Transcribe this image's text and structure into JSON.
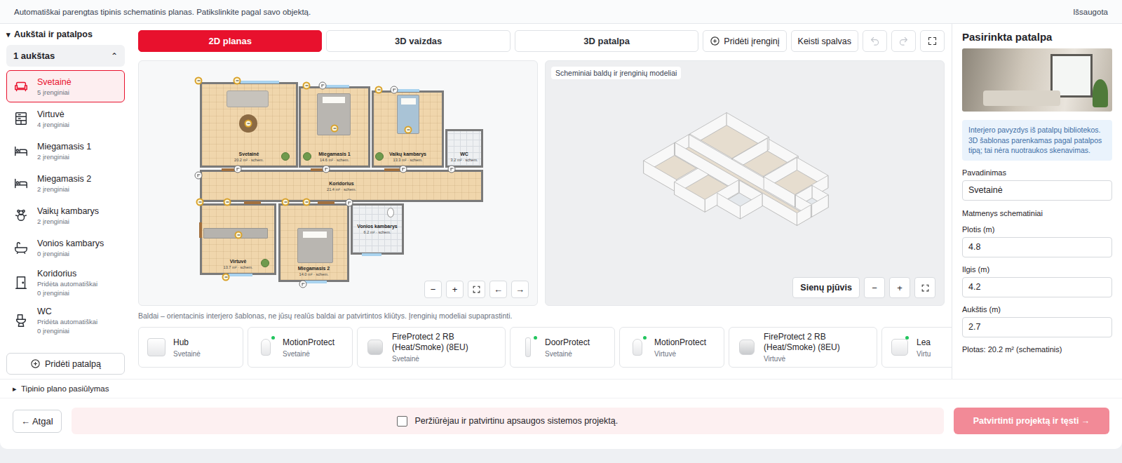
{
  "banner": {
    "text": "Automatiškai parengtas tipinis schematinis planas. Patikslinkite pagal savo objektą.",
    "status": "Išsaugota"
  },
  "sidebar": {
    "toggle": "▾",
    "title": "Aukštai ir patalpos",
    "expanded": true,
    "floor": {
      "label": "1 aukštas",
      "toggle": "⌃",
      "expanded": true
    },
    "rooms": [
      {
        "name": "Svetainė",
        "kind": "living",
        "count": "5 įrenginiai",
        "selected": true
      },
      {
        "name": "Virtuvė",
        "kind": "kitchen",
        "count": "4 įrenginiai",
        "selected": false
      },
      {
        "name": "Miegamasis 1",
        "kind": "bedroom",
        "count": "2 įrenginiai",
        "selected": false
      },
      {
        "name": "Miegamasis 2",
        "kind": "bedroom",
        "count": "2 įrenginiai",
        "selected": false
      },
      {
        "name": "Vaikų kambarys",
        "kind": "kids",
        "count": "2 įrenginiai",
        "selected": false
      },
      {
        "name": "Vonios kambarys",
        "kind": "bath",
        "count": "0 įrenginiai",
        "selected": false
      },
      {
        "name": "Koridorius",
        "kind": "corridor",
        "note": "Pridėta automatiškai",
        "count": "0 įrenginiai",
        "selected": false
      },
      {
        "name": "WC",
        "kind": "wc",
        "note": "Pridėta automatiškai",
        "count": "0 įrenginiai",
        "selected": false
      }
    ],
    "add_room": "Pridėti patalpą"
  },
  "tabs": [
    {
      "label": "2D planas",
      "selected": true
    },
    {
      "label": "3D vaizdas",
      "selected": false
    },
    {
      "label": "3D patalpa",
      "selected": false
    }
  ],
  "toolbar": {
    "buttons": [
      {
        "kind": "add",
        "label": "Pridėti įrenginį"
      },
      {
        "kind": "plain",
        "label": "Keisti spalvas"
      }
    ],
    "icons": [
      {
        "kind": "undo",
        "disabled": true
      },
      {
        "kind": "redo",
        "disabled": true
      },
      {
        "kind": "fullscreen",
        "disabled": false
      }
    ]
  },
  "plan": {
    "rooms": [
      {
        "name": "Svetainė",
        "area": "20.2 m² · schem.",
        "kind": "wood"
      },
      {
        "name": "Miegamasis 1",
        "area": "14.6 m² · schem.",
        "kind": "wood"
      },
      {
        "name": "Vaikų kambarys",
        "area": "13.3 m² · schem.",
        "kind": "wood"
      },
      {
        "name": "WC",
        "area": "3.2 m² · schem.",
        "kind": "tiles"
      },
      {
        "name": "Koridorius",
        "area": "21.4 m² · schem.",
        "kind": "wood"
      },
      {
        "name": "Virtuvė",
        "area": "13.7 m² · schem.",
        "kind": "wood"
      },
      {
        "name": "Miegamasis 2",
        "area": "14.0 m² · schem.",
        "kind": "wood"
      },
      {
        "name": "Vonios kambarys",
        "area": "6.2 m² · schem.",
        "kind": "tiles"
      }
    ],
    "controls": {
      "zoom_out": "−",
      "zoom_in": "+",
      "prev": "←",
      "next": "→"
    }
  },
  "view3d": {
    "badge": "Scheminiai baldų ir įrenginių modeliai",
    "section": "Sienų pjūvis",
    "zoom_out": "−",
    "zoom_in": "+"
  },
  "caption": "Baldai – orientacinis interjero šablonas, ne jūsų realūs baldai ar patvirtintos kliūtys. Įrenginių modeliai supaprastinti.",
  "devices": [
    {
      "name": "Hub",
      "room": "Svetainė",
      "kind": "hub",
      "online": false
    },
    {
      "name": "MotionProtect",
      "room": "Svetainė",
      "kind": "motion",
      "online": true
    },
    {
      "name": "FireProtect 2 RB (Heat/Smoke) (8EU)",
      "room": "Svetainė",
      "kind": "fire",
      "online": false
    },
    {
      "name": "DoorProtect",
      "room": "Svetainė",
      "kind": "door",
      "online": true
    },
    {
      "name": "MotionProtect",
      "room": "Virtuvė",
      "kind": "motion",
      "online": true
    },
    {
      "name": "FireProtect 2 RB (Heat/Smoke) (8EU)",
      "room": "Virtuvė",
      "kind": "fire",
      "online": false
    },
    {
      "name": "Lea",
      "room": "Virtu",
      "kind": "leak",
      "online": true
    }
  ],
  "details": {
    "toggle": "▸",
    "label": "Tipinio plano pasiūlymas",
    "expanded": false
  },
  "panel": {
    "title": "Pasirinkta patalpa",
    "info": "Interjero pavyzdys iš patalpų bibliotekos. 3D šablonas parenkamas pagal patalpos tipą; tai nėra nuotraukos skenavimas.",
    "name_field": {
      "label": "Pavadinimas",
      "value": "Svetainė"
    },
    "dimensions_title": "Matmenys schematiniai",
    "dimensions": [
      {
        "label": "Plotis (m)",
        "value": "4.8"
      },
      {
        "label": "Ilgis (m)",
        "value": "4.2"
      },
      {
        "label": "Aukštis (m)",
        "value": "2.7"
      }
    ],
    "area": "Plotas: 20.2 m² (schematinis)"
  },
  "footer": {
    "back": "← Atgal",
    "confirm": {
      "label": "Peržiūrėjau ir patvirtinu apsaugos sistemos projektą.",
      "checked": false
    },
    "submit": {
      "label": "Patvirtinti projektą ir tęsti →",
      "disabled": true
    }
  }
}
